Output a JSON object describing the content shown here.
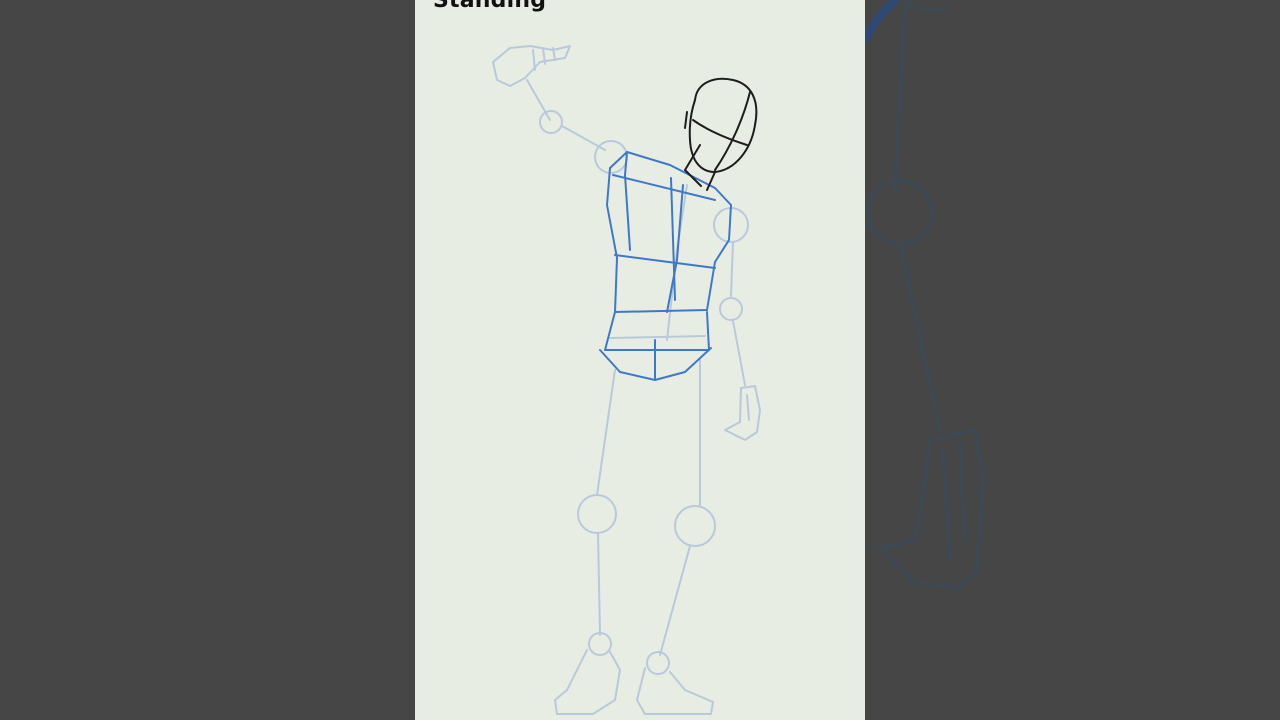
{
  "video": {
    "title": "Standing"
  },
  "colors": {
    "background_side": "#464646",
    "canvas": "#e8ede4",
    "sketch_light": "#b9c9dc",
    "sketch_blue": "#3f78c8",
    "sketch_dark": "#1d1d1d",
    "title_text": "#111111"
  },
  "drawing": {
    "subject": "standing-figure-sketch",
    "stages": [
      "light-construction-skeleton",
      "blue-torso-boxes",
      "black-head-outline"
    ]
  }
}
